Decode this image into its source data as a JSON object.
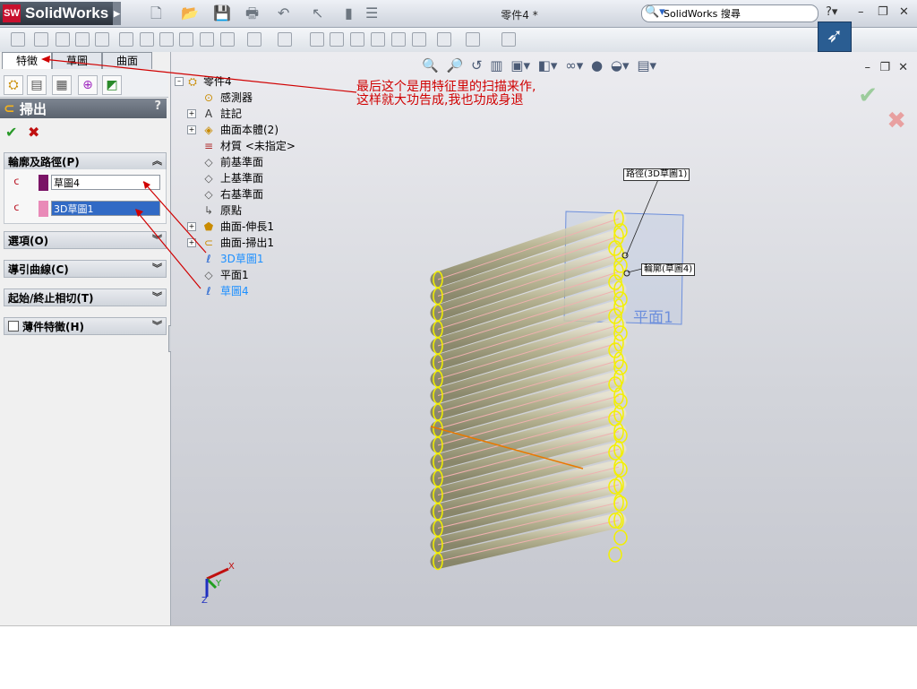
{
  "app": {
    "logo_text": "SolidWorks",
    "logo_badge": "SW",
    "doc_title": "零件4 *"
  },
  "search": {
    "placeholder": "SolidWorks 搜尋",
    "value": "SolidWorks 搜尋"
  },
  "tabs": [
    {
      "label": "特徵"
    },
    {
      "label": "草圖"
    },
    {
      "label": "曲面"
    }
  ],
  "property_manager": {
    "title": "掃出",
    "help": "?",
    "ok": "✔",
    "cancel": "✖",
    "profile_path_group": "輪廓及路徑(P)",
    "profile_field": "草圖4",
    "path_field": "3D草圖1",
    "options_group": "選項(O)",
    "guide_curves_group": "導引曲線(C)",
    "start_end_group": "起始/終止相切(T)",
    "thin_feature_group": "薄件特徵(H)"
  },
  "tree": {
    "root": "零件4",
    "items": [
      {
        "label": "感測器",
        "icon": "sensor-icon",
        "expand": false
      },
      {
        "label": "註記",
        "icon": "annotation-icon",
        "expand": true
      },
      {
        "label": "曲面本體(2)",
        "icon": "surface-bodies-icon",
        "expand": true
      },
      {
        "label": "材質 <未指定>",
        "icon": "material-icon",
        "expand": false
      },
      {
        "label": "前基準面",
        "icon": "plane-icon",
        "expand": false
      },
      {
        "label": "上基準面",
        "icon": "plane-icon",
        "expand": false
      },
      {
        "label": "右基準面",
        "icon": "plane-icon",
        "expand": false
      },
      {
        "label": "原點",
        "icon": "origin-icon",
        "expand": false
      },
      {
        "label": "曲面-伸長1",
        "icon": "extrude-icon",
        "expand": true
      },
      {
        "label": "曲面-掃出1",
        "icon": "sweep-icon",
        "expand": true
      },
      {
        "label": "3D草圖1",
        "icon": "3d-sketch-icon",
        "expand": false,
        "highlight": true
      },
      {
        "label": "平面1",
        "icon": "plane-icon",
        "expand": false
      },
      {
        "label": "草圖4",
        "icon": "sketch-icon",
        "expand": false,
        "highlight": true
      }
    ]
  },
  "annotation": {
    "text": "最后这个是用特征里的扫描来作,这样就大功告成,我也功成身退"
  },
  "callouts": {
    "path": "路徑(3D草圖1)",
    "profile": "輪廓(草圖4)",
    "plane_label": "平面1"
  },
  "triad": {
    "x": "X",
    "y": "Y",
    "z": "Z"
  },
  "colors": {
    "accent": "#316ac5",
    "annotation_red": "#d00000",
    "highlight_blue": "#1e90ff",
    "profile_swatch": "#7a1466",
    "path_swatch": "#e98ab8",
    "tube_yellow": "#f3f000"
  }
}
